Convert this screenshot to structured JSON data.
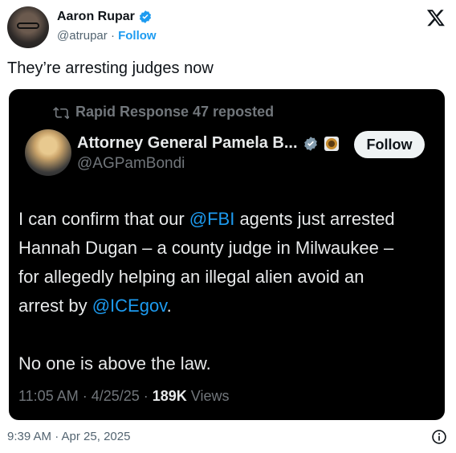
{
  "author": {
    "display_name": "Aaron Rupar",
    "handle": "@atrupar",
    "separator": "·",
    "follow_label": "Follow"
  },
  "tweet": {
    "text": "They’re arresting judges now",
    "timestamp": "9:39 AM · Apr 25, 2025"
  },
  "quoted": {
    "repost_text": "Rapid Response 47 reposted",
    "display_name": "Attorney General Pamela B...",
    "handle": "@AGPamBondi",
    "follow_label": "Follow",
    "body": {
      "l1_a": "I can confirm that our ",
      "l1_m": "@FBI",
      "l1_b": " agents just arrested",
      "l2": "Hannah Dugan – a county judge in Milwaukee –",
      "l3": "for allegedly helping an illegal alien avoid an",
      "l4_a": "arrest by ",
      "l4_m": "@ICEgov",
      "l4_b": ".",
      "l5": "No one is above the law."
    },
    "meta_time": "11:05 AM · 4/25/25 · ",
    "views_count": "189K",
    "views_label": " Views"
  },
  "icons": {
    "verified": "verified-badge-icon",
    "x_logo": "x-logo-icon",
    "repost": "repost-icon",
    "info": "info-icon",
    "affiliate": "government-seal-icon"
  },
  "colors": {
    "accent": "#1d9bf0",
    "quote_bg": "#000000",
    "muted": "#536471"
  }
}
